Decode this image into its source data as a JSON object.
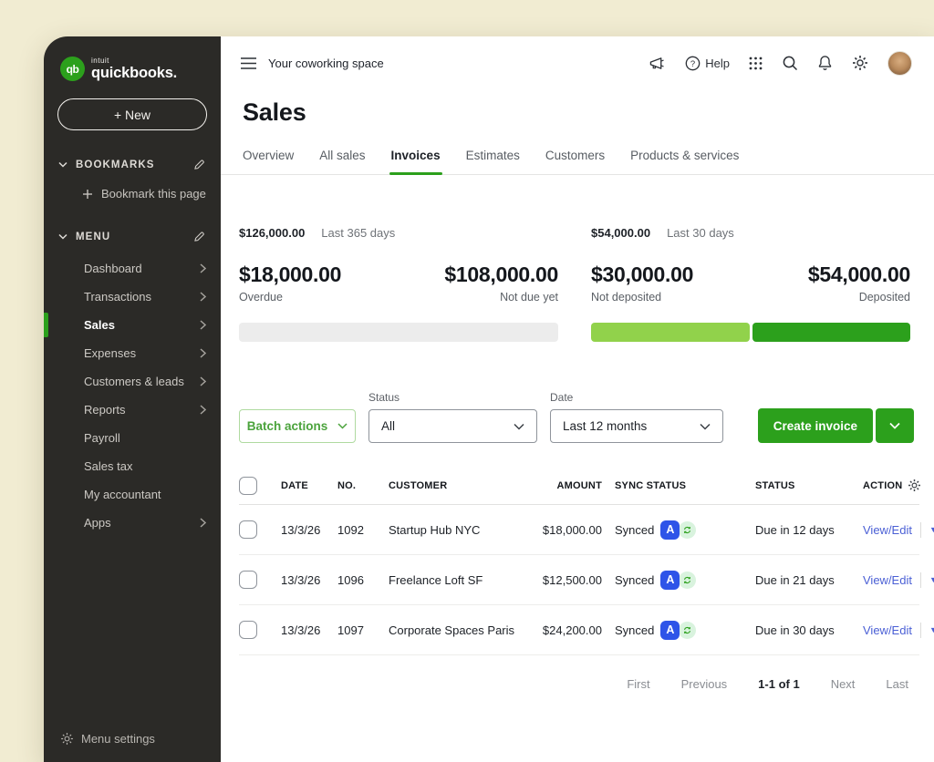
{
  "colors": {
    "brand_green": "#2ca01c",
    "bar_light_green": "#91d24b",
    "bar_dark_green": "#2ca01c",
    "bar_gray": "#ececec",
    "link_blue": "#4a5fd5",
    "sync_badge_blue": "#2e54e8",
    "sync_badge_mint": "#d9f3de",
    "sidebar_bg": "#2b2a27",
    "canvas_cream": "#f1ecd2"
  },
  "brand": {
    "company": "intuit",
    "product": "quickbooks."
  },
  "sidebar": {
    "new_button": "+ New",
    "bookmarks_header": "BOOKMARKS",
    "bookmark_this_page": "Bookmark this page",
    "menu_header": "MENU",
    "items": [
      {
        "label": "Dashboard"
      },
      {
        "label": "Transactions"
      },
      {
        "label": "Sales"
      },
      {
        "label": "Expenses"
      },
      {
        "label": "Customers & leads"
      },
      {
        "label": "Reports"
      },
      {
        "label": "Payroll"
      },
      {
        "label": "Sales tax"
      },
      {
        "label": "My accountant"
      },
      {
        "label": "Apps"
      }
    ],
    "menu_settings": "Menu settings"
  },
  "topbar": {
    "workspace": "Your coworking space",
    "help_label": "Help"
  },
  "page_title": "Sales",
  "tabs": [
    {
      "label": "Overview"
    },
    {
      "label": "All sales"
    },
    {
      "label": "Invoices"
    },
    {
      "label": "Estimates"
    },
    {
      "label": "Customers"
    },
    {
      "label": "Products & services"
    }
  ],
  "summary": {
    "unpaid": {
      "total": "$126,000.00",
      "period": "Last 365 days",
      "left_amount": "$18,000.00",
      "left_label": "Overdue",
      "right_amount": "$108,000.00",
      "right_label": "Not due yet",
      "segments": [
        {
          "color": "#ececec",
          "pct": 100
        }
      ]
    },
    "paid": {
      "total": "$54,000.00",
      "period": "Last 30 days",
      "left_amount": "$30,000.00",
      "left_label": "Not deposited",
      "right_amount": "$54,000.00",
      "right_label": "Deposited",
      "segments": [
        {
          "color": "#91d24b",
          "pct": 50
        },
        {
          "color": "#2ca01c",
          "pct": 50
        }
      ]
    }
  },
  "filters": {
    "batch_actions": "Batch actions",
    "status_label": "Status",
    "status_value": "All",
    "date_label": "Date",
    "date_value": "Last 12 months",
    "create_invoice": "Create invoice"
  },
  "table": {
    "headers": {
      "date": "DATE",
      "no": "NO.",
      "customer": "CUSTOMER",
      "amount": "AMOUNT",
      "sync": "SYNC STATUS",
      "status": "STATUS",
      "action": "ACTION"
    },
    "sync_badge_letter": "A",
    "rows": [
      {
        "date": "13/3/26",
        "no": "1092",
        "customer": "Startup Hub NYC",
        "amount": "$18,000.00",
        "sync": "Synced",
        "status": "Due in 12 days",
        "action": "View/Edit"
      },
      {
        "date": "13/3/26",
        "no": "1096",
        "customer": "Freelance Loft SF",
        "amount": "$12,500.00",
        "sync": "Synced",
        "status": "Due in 21 days",
        "action": "View/Edit"
      },
      {
        "date": "13/3/26",
        "no": "1097",
        "customer": "Corporate Spaces Paris",
        "amount": "$24,200.00",
        "sync": "Synced",
        "status": "Due in 30 days",
        "action": "View/Edit"
      }
    ]
  },
  "pagination": {
    "first": "First",
    "previous": "Previous",
    "range": "1-1 of 1",
    "next": "Next",
    "last": "Last"
  }
}
